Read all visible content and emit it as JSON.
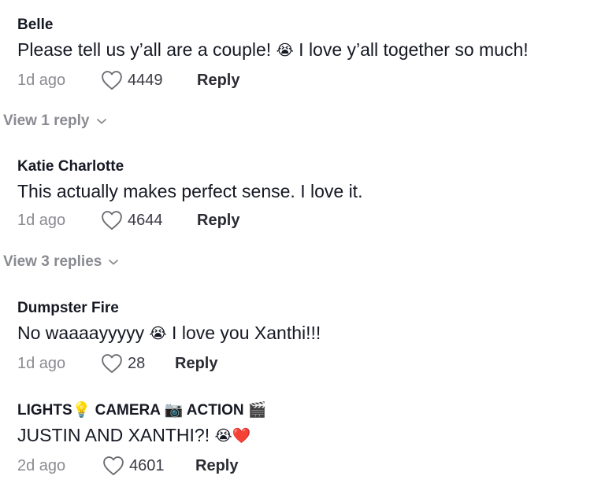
{
  "comments": [
    {
      "username": "Belle",
      "text_before": "Please tell us y’all are a couple! ",
      "emoji": "😭",
      "text_after": " I love y’all together so much!",
      "age": "1d ago",
      "likes": "4449",
      "reply_label": "Reply",
      "view_replies": "View 1 reply"
    },
    {
      "username": "Katie Charlotte",
      "text_before": "This actually makes perfect sense. I love it.",
      "emoji": "",
      "text_after": "",
      "age": "1d ago",
      "likes": "4644",
      "reply_label": "Reply",
      "view_replies": "View 3 replies"
    },
    {
      "username": "Dumpster Fire",
      "text_before": "No waaaayyyyy ",
      "emoji": "😭",
      "text_after": " I love you Xanthi!!!",
      "age": "1d ago",
      "likes": "28",
      "reply_label": "Reply"
    },
    {
      "username": "LIGHTS💡 CAMERA 📷 ACTION 🎬",
      "text_before": "JUSTIN AND XANTHI?! ",
      "emoji": "😭❤️",
      "text_after": "",
      "age": "2d ago",
      "likes": "4601",
      "reply_label": "Reply"
    }
  ],
  "icons": {
    "like": "heart-outline-icon",
    "expand": "chevron-down-icon"
  },
  "colors": {
    "text": "#161823",
    "muted": "#8a8b91"
  }
}
